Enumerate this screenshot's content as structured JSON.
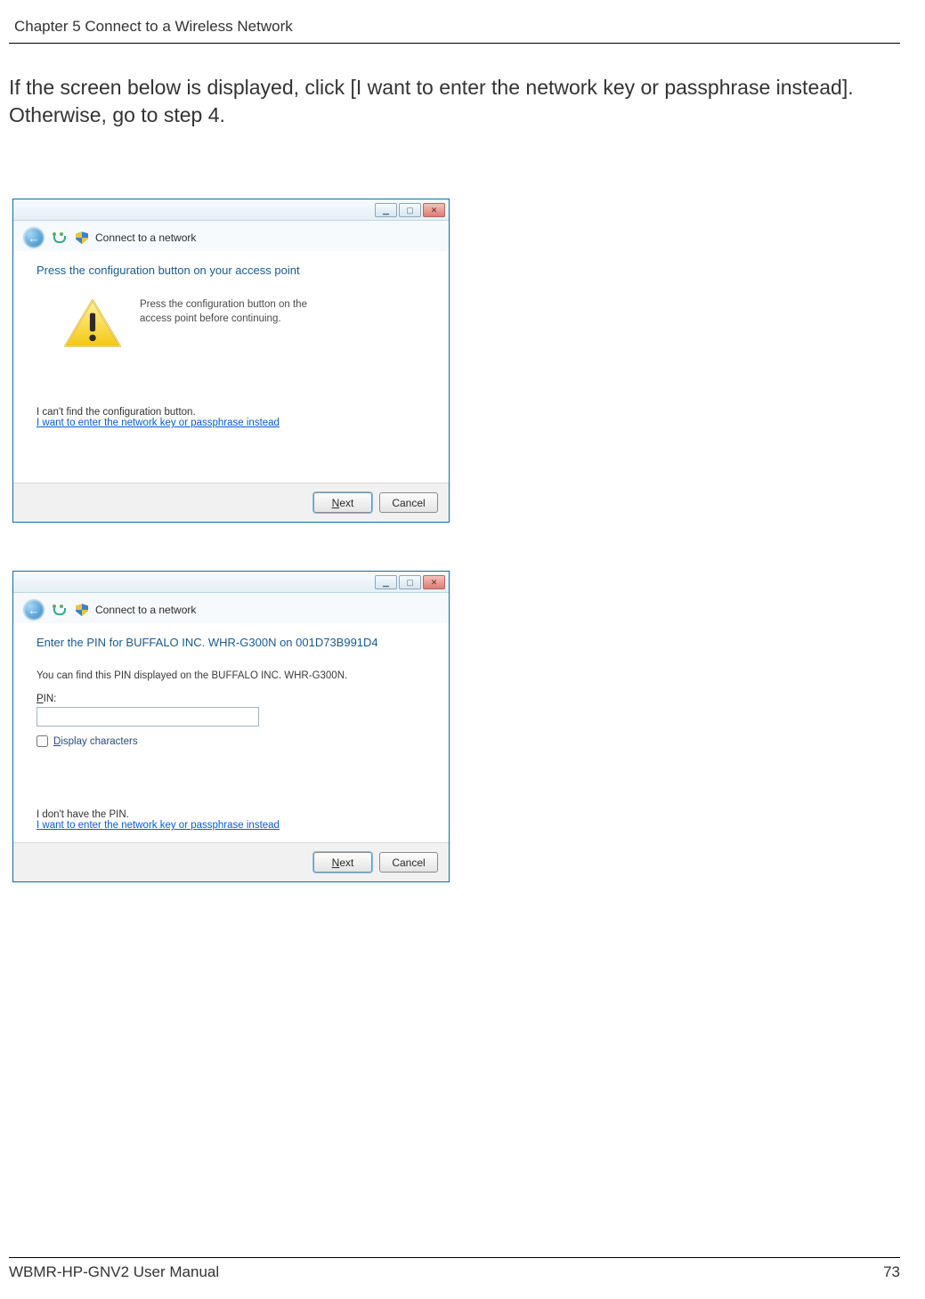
{
  "header": {
    "text": "Chapter 5  Connect to a Wireless Network"
  },
  "intro": "If the screen below is displayed, click [I want to enter the network key or passphrase instead]. Otherwise, go to step 4.",
  "dialog1": {
    "window_controls": {
      "min": "▁",
      "max": "▢",
      "close": "✕"
    },
    "nav_title": "Connect to a network",
    "heading": "Press the configuration button on your access point",
    "warn_text": "Press the configuration button on the access point before continuing.",
    "help_line": "I can't find the configuration button.",
    "link_text": "I want to enter the network key or passphrase instead",
    "next": "Next",
    "cancel": "Cancel"
  },
  "dialog2": {
    "window_controls": {
      "min": "▁",
      "max": "▢",
      "close": "✕"
    },
    "nav_title": "Connect to a network",
    "heading": "Enter the PIN for BUFFALO INC. WHR-G300N on 001D73B991D4",
    "pin_hint": "You can find this PIN displayed on the BUFFALO INC. WHR-G300N.",
    "pin_label": "PIN:",
    "pin_value": "",
    "display_chars": "Display characters",
    "help_line": "I don't have the PIN.",
    "link_text": "I want to enter the network key or passphrase instead",
    "next": "Next",
    "cancel": "Cancel"
  },
  "footer": {
    "left": "WBMR-HP-GNV2 User Manual",
    "right": "73"
  }
}
